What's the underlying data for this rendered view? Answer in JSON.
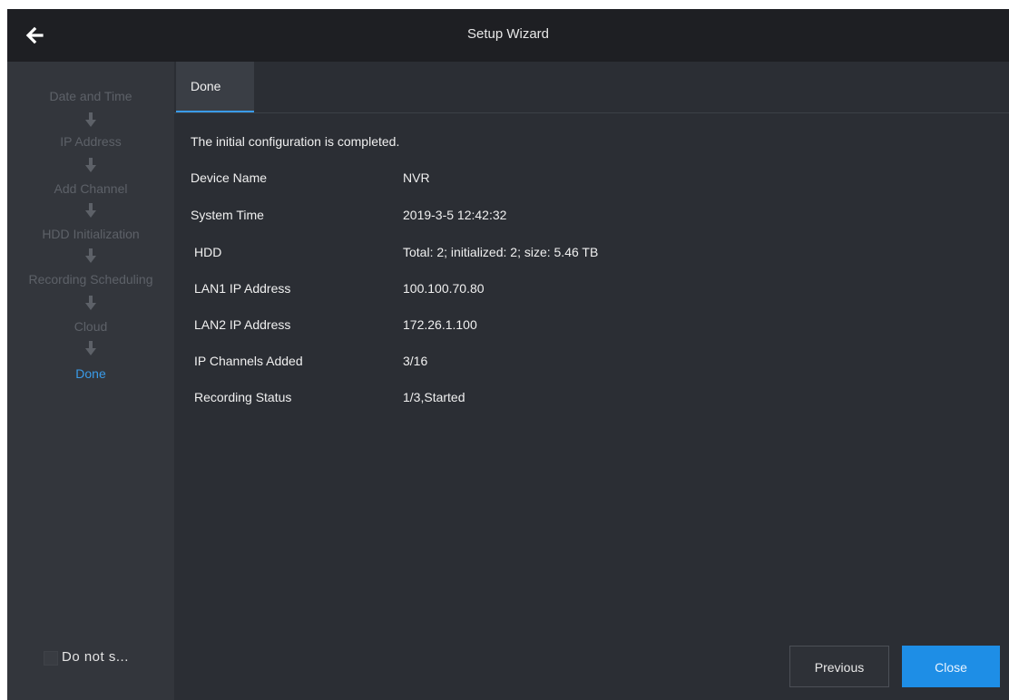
{
  "window": {
    "title": "Setup Wizard",
    "back_icon": "arrow-left-icon"
  },
  "sidebar": {
    "steps": [
      {
        "label": "Date and Time",
        "state": "inactive"
      },
      {
        "label": "IP Address",
        "state": "inactive"
      },
      {
        "label": "Add Channel",
        "state": "inactive"
      },
      {
        "label": "HDD Initialization",
        "state": "inactive"
      },
      {
        "label": "Recording Scheduling",
        "state": "inactive"
      },
      {
        "label": "Cloud",
        "state": "inactive"
      },
      {
        "label": "Done",
        "state": "active"
      }
    ],
    "arrow_icon": "arrow-down-icon",
    "dont_show": {
      "label": "Do not s...",
      "checked": false
    }
  },
  "tabs": [
    {
      "label": "Done",
      "selected": true
    }
  ],
  "summary": {
    "message": "The initial configuration is completed.",
    "rows": [
      {
        "label": "Device Name",
        "value": "NVR"
      },
      {
        "label": "System Time",
        "value": "2019-3-5  12:42:32"
      },
      {
        "label": "HDD",
        "value": "Total: 2; initialized: 2; size: 5.46 TB"
      },
      {
        "label": "LAN1 IP Address",
        "value": "100.100.70.80"
      },
      {
        "label": "LAN2 IP Address",
        "value": "172.26.1.100"
      },
      {
        "label": "IP Channels Added",
        "value": "3/16"
      },
      {
        "label": "Recording Status",
        "value": "1/3,Started"
      }
    ]
  },
  "buttons": {
    "previous": "Previous",
    "close": "Close"
  },
  "colors": {
    "accent": "#1e8ee6",
    "active_step": "#3a9be8",
    "inactive_step": "#5d6168",
    "background": "#2b2e34",
    "titlebar": "#1e1f23"
  }
}
